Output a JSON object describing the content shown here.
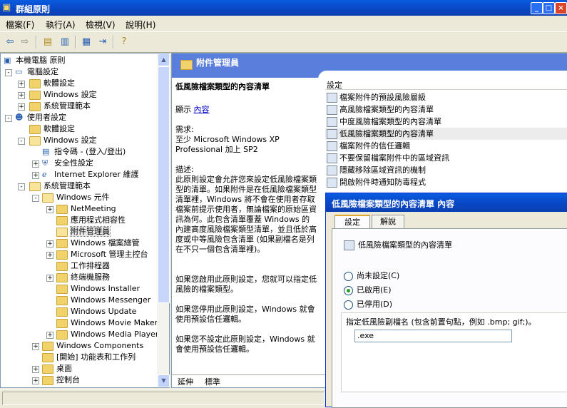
{
  "window": {
    "title": "群組原則"
  },
  "menu": [
    "檔案(F)",
    "執行(A)",
    "檢視(V)",
    "說明(H)"
  ],
  "toolbar_icons": [
    "back-icon",
    "forward-icon",
    "up-folder-icon",
    "show-tree-icon",
    "properties-icon",
    "export-list-icon",
    "help-icon"
  ],
  "tree": {
    "nodes": [
      {
        "label": "本機電腦 原則",
        "depth": 0
      },
      {
        "label": "電腦設定",
        "depth": 1,
        "pm": "-"
      },
      {
        "label": "軟體設定",
        "depth": 2,
        "pm": "+"
      },
      {
        "label": "Windows 設定",
        "depth": 2,
        "pm": "+"
      },
      {
        "label": "系統管理範本",
        "depth": 2,
        "pm": "+"
      },
      {
        "label": "使用者設定",
        "depth": 1,
        "pm": "-"
      },
      {
        "label": "軟體設定",
        "depth": 2
      },
      {
        "label": "Windows 設定",
        "depth": 2,
        "pm": "-"
      },
      {
        "label": "指令碼 - (登入/登出)",
        "depth": 3
      },
      {
        "label": "安全性設定",
        "depth": 3,
        "pm": "+"
      },
      {
        "label": "Internet Explorer 維護",
        "depth": 3,
        "pm": "+"
      },
      {
        "label": "系統管理範本",
        "depth": 2,
        "pm": "-"
      },
      {
        "label": "Windows 元件",
        "depth": 3,
        "pm": "-"
      },
      {
        "label": "NetMeeting",
        "depth": 4,
        "pm": "+"
      },
      {
        "label": "應用程式相容性",
        "depth": 4
      },
      {
        "label": "附件管理員",
        "depth": 4,
        "selected": true
      },
      {
        "label": "Windows 檔案總管",
        "depth": 4,
        "pm": "+"
      },
      {
        "label": "Microsoft 管理主控台",
        "depth": 4,
        "pm": "+"
      },
      {
        "label": "工作排程器",
        "depth": 4
      },
      {
        "label": "終端機服務",
        "depth": 4,
        "pm": "+"
      },
      {
        "label": "Windows Installer",
        "depth": 4
      },
      {
        "label": "Windows Messenger",
        "depth": 4
      },
      {
        "label": "Windows Update",
        "depth": 4
      },
      {
        "label": "Windows Movie Maker",
        "depth": 4
      },
      {
        "label": "Windows Media Player",
        "depth": 4,
        "pm": "+"
      },
      {
        "label": "Windows Components",
        "depth": 3,
        "pm": "+"
      },
      {
        "label": "[開始] 功能表和工作列",
        "depth": 3
      },
      {
        "label": "桌面",
        "depth": 3,
        "pm": "+"
      },
      {
        "label": "控制台",
        "depth": 3,
        "pm": "+"
      }
    ]
  },
  "right": {
    "header": "附件管理員",
    "desc": {
      "title": "低風險檔案類型的內容清單",
      "display_label": "顯示",
      "display_link": "內容",
      "req_label": "需求:",
      "req_text": "至少 Microsoft Windows XP Professional 加上 SP2",
      "desc_label": "描述:",
      "desc_text": "此原則設定會允許您來設定低風險檔案類型的清單。如果附件是在低風險檔案類型清單裡，Windows 將不會在使用者存取檔案前提示使用者，無論檔案的原始區資訊為何。此包含清單覆蓋 Windows 的內建高度風險檔案類型清單，並且低於高度或中等風險包含清單 (如果副檔名是列在不只一個包含清單裡)。",
      "p2": "如果您啟用此原則設定，您就可以指定低風險的檔案類型。",
      "p3": "如果您停用此原則設定，Windows 就會使用預設信任邏輯。",
      "p4": "如果您不設定此原則設定，Windows 就會使用預設信任邏輯。"
    },
    "settings_header": "設定",
    "settings": [
      "檔案附件的預設風險層級",
      "高風險檔案類型的內容清單",
      "中度風險檔案類型的內容清單",
      "低風險檔案類型的內容清單",
      "檔案附件的信任邏輯",
      "不要保留檔案附件中的區域資訊",
      "隱藏移除區域資訊的機制",
      "開啟附件時通知防毒程式"
    ],
    "tabs": [
      "延伸",
      "標準"
    ]
  },
  "dialog": {
    "title": "低風險檔案類型的內容清單 內容",
    "tabs": [
      "設定",
      "解說"
    ],
    "setting_name": "低風險檔案類型的內容清單",
    "options": [
      "尚未設定(C)",
      "已啟用(E)",
      "已停用(D)"
    ],
    "selected_option": 1,
    "ext_label": "指定低風險副檔名 (包含前置句點，例如 .bmp; gif;)。",
    "ext_value": ".exe"
  }
}
